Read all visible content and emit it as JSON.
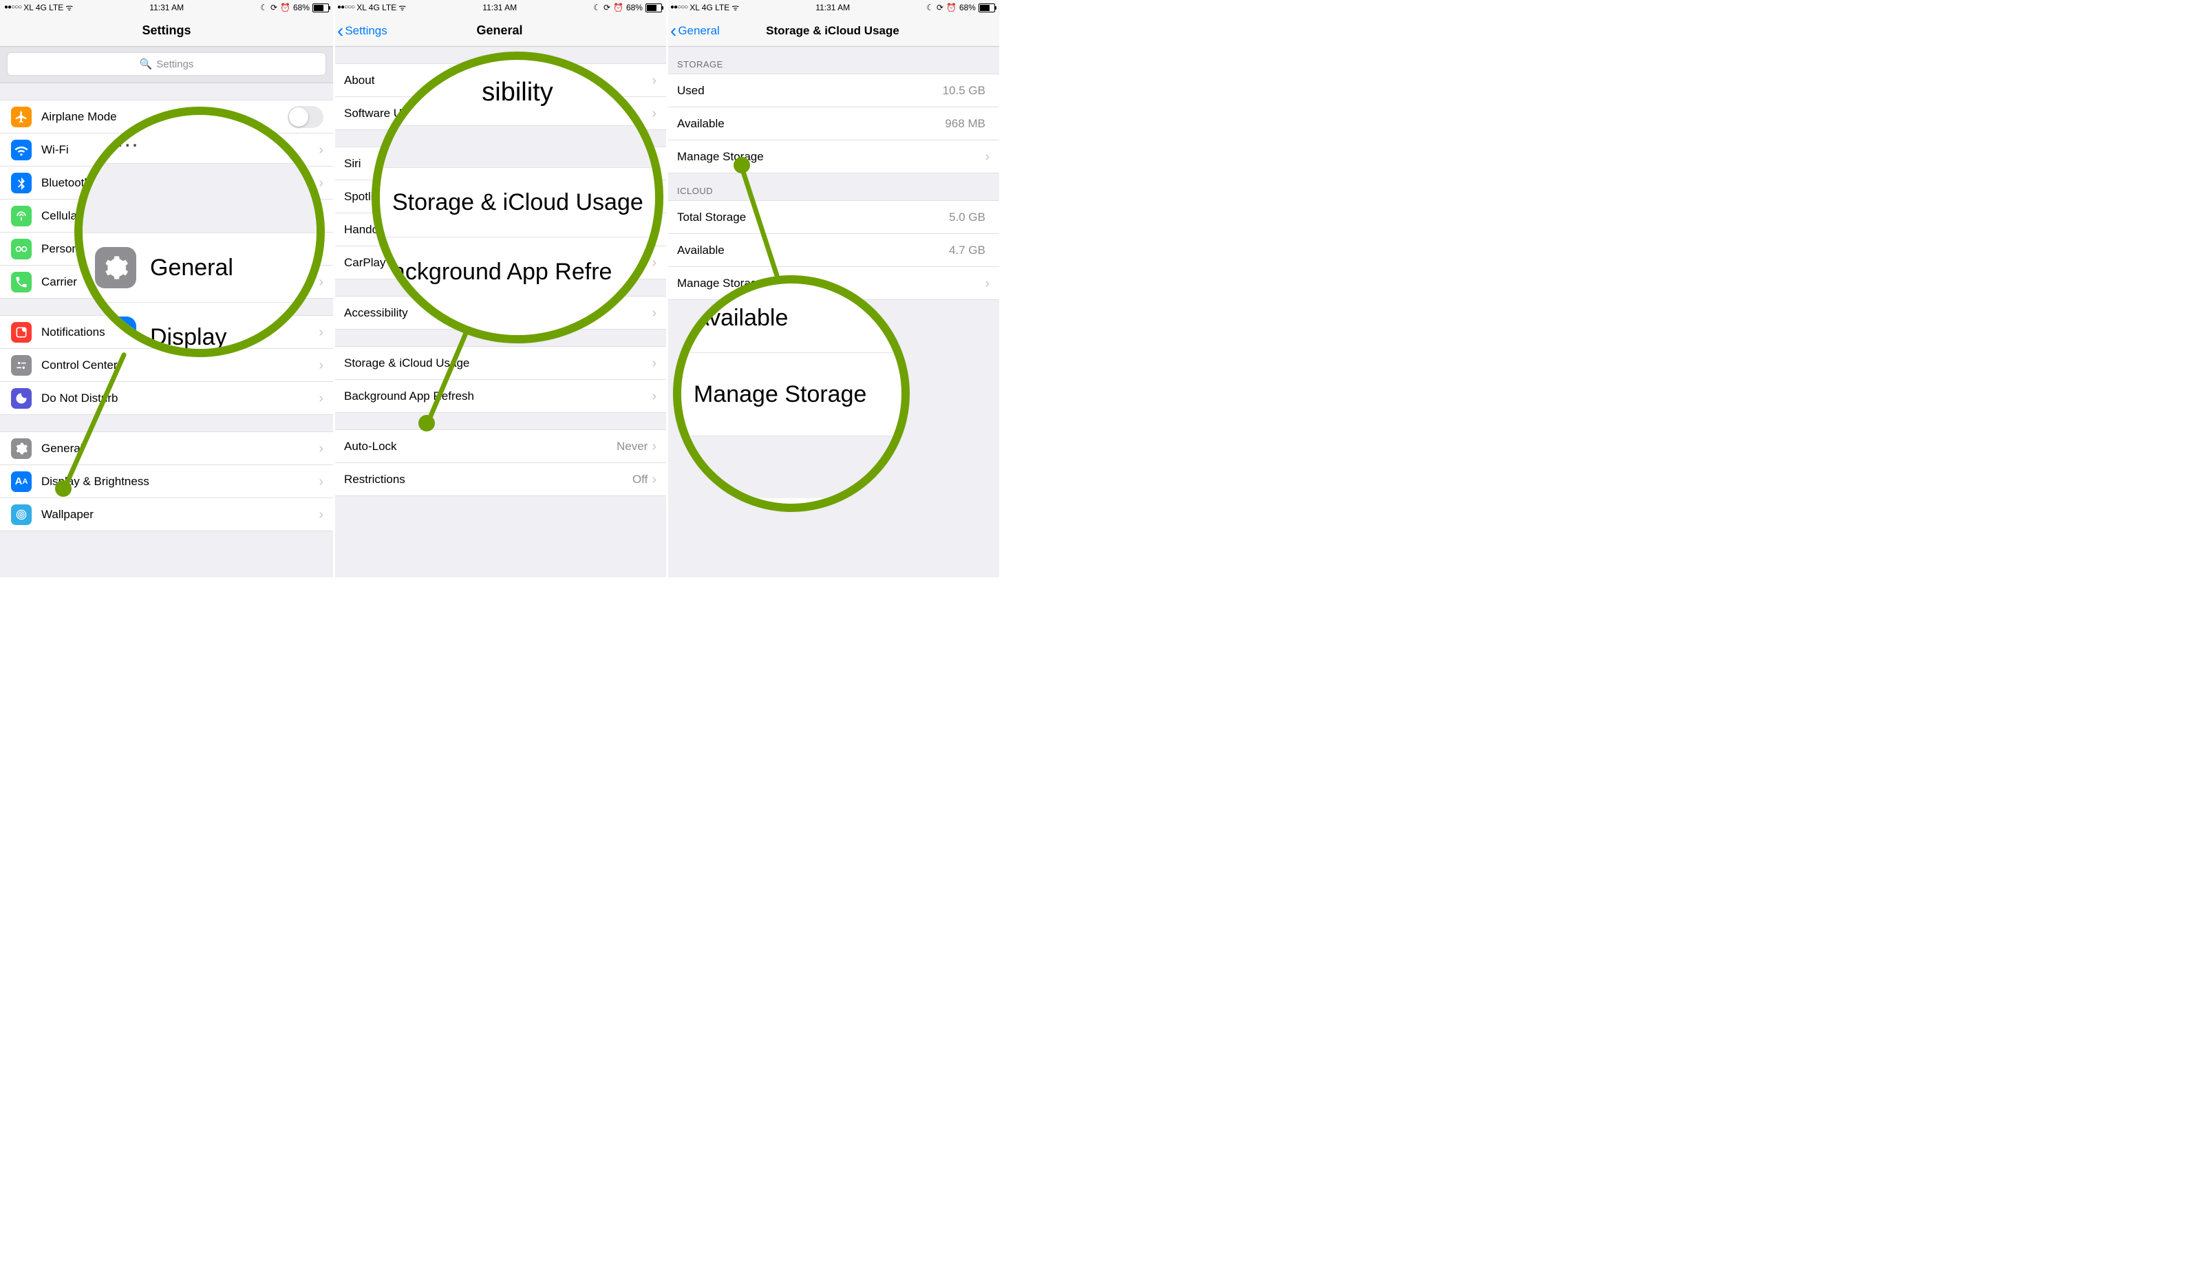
{
  "status": {
    "carrier": "XL 4G LTE",
    "time": "11:31 AM",
    "battery_pct": "68%"
  },
  "nav": {
    "settings_title": "Settings",
    "general_title": "General",
    "general_back": "Settings",
    "storage_title": "Storage & iCloud Usage",
    "storage_back": "General"
  },
  "search": {
    "placeholder": "Settings"
  },
  "settings_rows": {
    "airplane": "Airplane Mode",
    "wifi": "Wi-Fi",
    "bluetooth": "Bluetooth",
    "cellular": "Cellular",
    "hotspot": "Personal Hotspot",
    "carrier": "Carrier",
    "notifications": "Notifications",
    "control_center": "Control Center",
    "dnd": "Do Not Disturb",
    "general": "General",
    "display": "Display & Brightness",
    "wallpaper": "Wallpaper"
  },
  "general_rows": {
    "about": "About",
    "software": "Software Update",
    "siri": "Siri",
    "spotlight": "Spotlight Search",
    "handoff": "Handoff",
    "carplay": "CarPlay",
    "accessibility": "Accessibility",
    "storage": "Storage & iCloud Usage",
    "bgrefresh": "Background App Refresh",
    "autolock": "Auto-Lock",
    "autolock_value": "Never",
    "restrictions": "Restrictions",
    "restrictions_value": "Off"
  },
  "storage_page": {
    "section_storage": "STORAGE",
    "used": "Used",
    "used_value": "10.5 GB",
    "available": "Available",
    "available_value": "968 MB",
    "manage": "Manage Storage",
    "section_icloud": "ICLOUD",
    "icloud_total": "Total Storage",
    "icloud_total_value": "5.0 GB",
    "icloud_avail": "Available",
    "icloud_avail_value": "4.7 GB",
    "icloud_manage": "Manage Storage"
  },
  "mag1": {
    "line1": "General",
    "line2": "Display"
  },
  "mag2": {
    "top": "sibility",
    "mid": "Storage & iCloud Usage",
    "bot": "ackground App Refre"
  },
  "mag3": {
    "top": "Available",
    "mid": "Manage Storage"
  },
  "highlight_color": "#6ea000"
}
